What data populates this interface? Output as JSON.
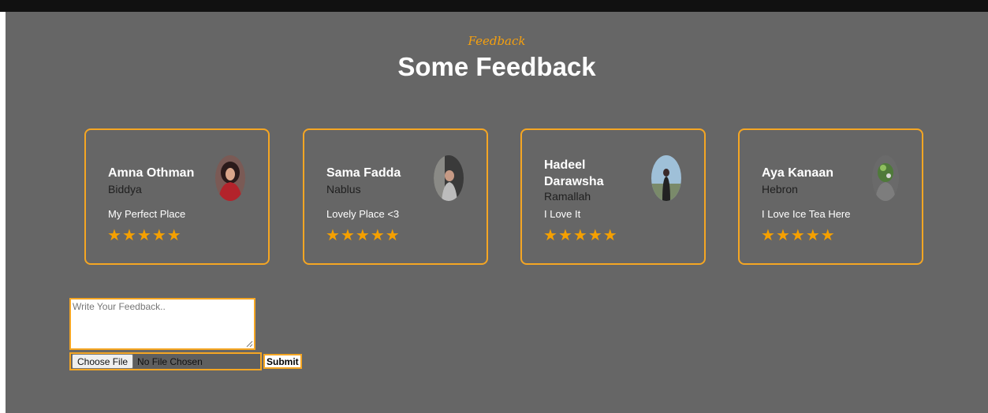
{
  "section": {
    "kicker": "Feedback",
    "title": "Some Feedback"
  },
  "cards": [
    {
      "name": "Amna Othman",
      "city": "Biddya",
      "comment": "My Perfect Place",
      "rating": 5
    },
    {
      "name": "Sama Fadda",
      "city": "Nablus",
      "comment": "Lovely Place <3",
      "rating": 5
    },
    {
      "name": "Hadeel Darawsha",
      "city": "Ramallah",
      "comment": "I Love It",
      "rating": 5
    },
    {
      "name": "Aya Kanaan",
      "city": "Hebron",
      "comment": "I Love Ice Tea Here",
      "rating": 5
    }
  ],
  "form": {
    "feedback_placeholder": "Write Your Feedback..",
    "choose_file_label": "Choose File",
    "file_status": "No File Chosen",
    "submit_label": "Submit"
  },
  "colors": {
    "accent": "#f5a623",
    "panel_bg": "#666666"
  }
}
